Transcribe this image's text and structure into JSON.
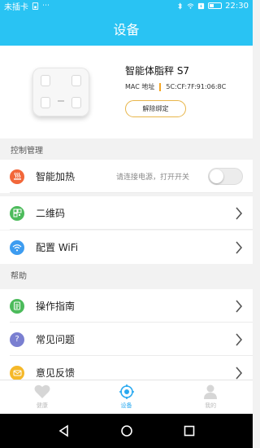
{
  "status_bar": {
    "carrier": "未插卡",
    "time": "22:30"
  },
  "title_bar": {
    "title": "设备"
  },
  "device": {
    "name": "智能体脂秤 S7",
    "mac_label": "MAC 地址",
    "mac_value": "5C:CF:7F:91:06:8C",
    "unbind_label": "解除绑定"
  },
  "sections": {
    "control": {
      "title": "控制管理",
      "items": [
        {
          "label": "智能加热",
          "hint": "请连接电源，打开开关",
          "icon": "heater-icon",
          "color": "#f2673a"
        },
        {
          "label": "二维码",
          "icon": "qrcode-icon",
          "color": "#4cbb5b"
        },
        {
          "label": "配置 WiFi",
          "icon": "wifi-icon",
          "color": "#3d9cf0"
        }
      ]
    },
    "help": {
      "title": "帮助",
      "items": [
        {
          "label": "操作指南",
          "icon": "guide-icon",
          "color": "#4cbb5b"
        },
        {
          "label": "常见问题",
          "icon": "question-icon",
          "color": "#7a7fd1"
        },
        {
          "label": "意见反馈",
          "icon": "feedback-icon",
          "color": "#f5b829"
        }
      ]
    }
  },
  "tabs": [
    {
      "label": "健康",
      "icon": "heart-icon",
      "active": false
    },
    {
      "label": "设备",
      "icon": "device-target-icon",
      "active": true
    },
    {
      "label": "我的",
      "icon": "user-icon",
      "active": false
    }
  ],
  "colors": {
    "primary": "#29c3f3",
    "accent_tab": "#29a9f0",
    "unbind_border": "#e8b64a"
  }
}
